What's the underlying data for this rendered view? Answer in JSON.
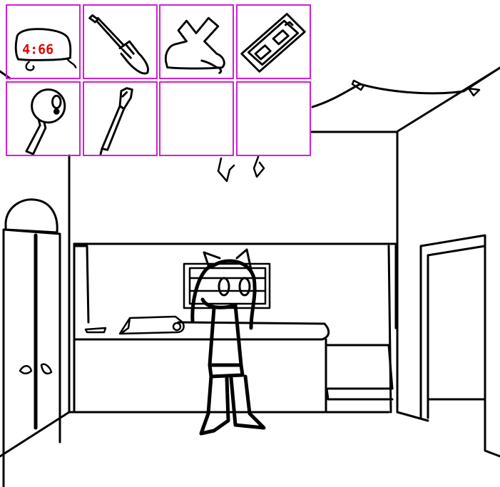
{
  "colors": {
    "slot_border": "#d21fd2",
    "ink": "#000000",
    "clock_digits": "#e60000",
    "background": "#ffffff"
  },
  "inventory": {
    "items": [
      {
        "icon": "digital-clock-icon",
        "display": "4:66"
      },
      {
        "icon": "screwdriver-icon"
      },
      {
        "icon": "crossed-tape-icon"
      },
      {
        "icon": "battery-pack-icon"
      },
      {
        "icon": "magnifying-glass-icon"
      },
      {
        "icon": "pen-icon"
      },
      {
        "icon": "empty-slot"
      },
      {
        "icon": "empty-slot"
      }
    ]
  }
}
